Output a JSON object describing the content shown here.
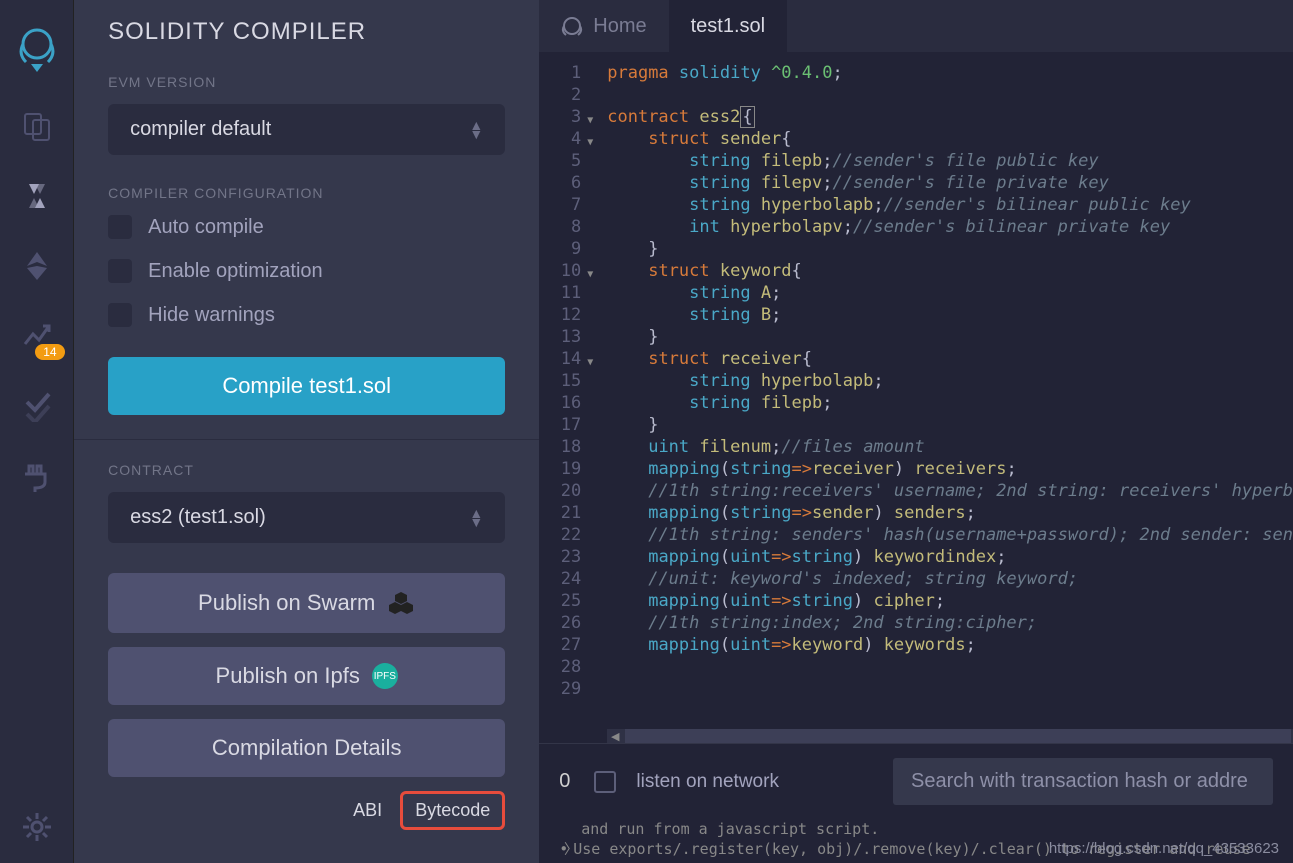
{
  "title": "SOLIDITY COMPILER",
  "evm_label": "EVM VERSION",
  "evm_value": "compiler default",
  "config_label": "COMPILER CONFIGURATION",
  "checks": {
    "auto": "Auto compile",
    "opt": "Enable optimization",
    "hide": "Hide warnings"
  },
  "compile_btn": "Compile test1.sol",
  "contract_label": "CONTRACT",
  "contract_value": "ess2 (test1.sol)",
  "swarm_btn": "Publish on Swarm",
  "ipfs_btn": "Publish on Ipfs",
  "details_btn": "Compilation Details",
  "abi_link": "ABI",
  "bytecode_link": "Bytecode",
  "badge": "14",
  "tabs": {
    "home": "Home",
    "file": "test1.sol"
  },
  "lines": [
    {
      "n": "1",
      "t": [
        {
          "c": "kw",
          "s": "pragma"
        },
        {
          "c": "pn",
          "s": " "
        },
        {
          "c": "tv",
          "s": "solidity"
        },
        {
          "c": "pn",
          "s": " "
        },
        {
          "c": "str",
          "s": "^0.4.0"
        },
        {
          "c": "pn",
          "s": ";"
        }
      ]
    },
    {
      "n": "2",
      "t": []
    },
    {
      "n": "3",
      "fold": true,
      "t": [
        {
          "c": "kw",
          "s": "contract"
        },
        {
          "c": "pn",
          "s": " "
        },
        {
          "c": "id",
          "s": "ess2"
        },
        {
          "c": "pn cursor-bracket",
          "s": "{"
        }
      ]
    },
    {
      "n": "4",
      "fold": true,
      "indent": 1,
      "t": [
        {
          "c": "kw",
          "s": "struct"
        },
        {
          "c": "pn",
          "s": " "
        },
        {
          "c": "id",
          "s": "sender"
        },
        {
          "c": "pn",
          "s": "{"
        }
      ]
    },
    {
      "n": "5",
      "indent": 2,
      "t": [
        {
          "c": "tv",
          "s": "string"
        },
        {
          "c": "pn",
          "s": " "
        },
        {
          "c": "id",
          "s": "filepb"
        },
        {
          "c": "pn",
          "s": ";"
        },
        {
          "c": "cm",
          "s": "//sender's file public key"
        }
      ]
    },
    {
      "n": "6",
      "indent": 2,
      "t": [
        {
          "c": "tv",
          "s": "string"
        },
        {
          "c": "pn",
          "s": " "
        },
        {
          "c": "id",
          "s": "filepv"
        },
        {
          "c": "pn",
          "s": ";"
        },
        {
          "c": "cm",
          "s": "//sender's file private key"
        }
      ]
    },
    {
      "n": "7",
      "indent": 2,
      "t": [
        {
          "c": "tv",
          "s": "string"
        },
        {
          "c": "pn",
          "s": " "
        },
        {
          "c": "id",
          "s": "hyperbolapb"
        },
        {
          "c": "pn",
          "s": ";"
        },
        {
          "c": "cm",
          "s": "//sender's bilinear public key"
        }
      ]
    },
    {
      "n": "8",
      "indent": 2,
      "t": [
        {
          "c": "tv",
          "s": "int"
        },
        {
          "c": "pn",
          "s": " "
        },
        {
          "c": "id",
          "s": "hyperbolapv"
        },
        {
          "c": "pn",
          "s": ";"
        },
        {
          "c": "cm",
          "s": "//sender's bilinear private key"
        }
      ]
    },
    {
      "n": "9",
      "indent": 1,
      "t": [
        {
          "c": "pn",
          "s": "}"
        }
      ]
    },
    {
      "n": "10",
      "fold": true,
      "indent": 1,
      "t": [
        {
          "c": "kw",
          "s": "struct"
        },
        {
          "c": "pn",
          "s": " "
        },
        {
          "c": "id",
          "s": "keyword"
        },
        {
          "c": "pn",
          "s": "{"
        }
      ]
    },
    {
      "n": "11",
      "indent": 2,
      "t": [
        {
          "c": "tv",
          "s": "string"
        },
        {
          "c": "pn",
          "s": " "
        },
        {
          "c": "id",
          "s": "A"
        },
        {
          "c": "pn",
          "s": ";"
        }
      ]
    },
    {
      "n": "12",
      "indent": 2,
      "t": [
        {
          "c": "tv",
          "s": "string"
        },
        {
          "c": "pn",
          "s": " "
        },
        {
          "c": "id",
          "s": "B"
        },
        {
          "c": "pn",
          "s": ";"
        }
      ]
    },
    {
      "n": "13",
      "indent": 1,
      "t": [
        {
          "c": "pn",
          "s": "}"
        }
      ]
    },
    {
      "n": "14",
      "fold": true,
      "indent": 1,
      "t": [
        {
          "c": "kw",
          "s": "struct"
        },
        {
          "c": "pn",
          "s": " "
        },
        {
          "c": "id",
          "s": "receiver"
        },
        {
          "c": "pn",
          "s": "{"
        }
      ]
    },
    {
      "n": "15",
      "indent": 2,
      "t": [
        {
          "c": "tv",
          "s": "string"
        },
        {
          "c": "pn",
          "s": " "
        },
        {
          "c": "id",
          "s": "hyperbolapb"
        },
        {
          "c": "pn",
          "s": ";"
        }
      ]
    },
    {
      "n": "16",
      "indent": 2,
      "t": [
        {
          "c": "tv",
          "s": "string"
        },
        {
          "c": "pn",
          "s": " "
        },
        {
          "c": "id",
          "s": "filepb"
        },
        {
          "c": "pn",
          "s": ";"
        }
      ]
    },
    {
      "n": "17",
      "indent": 1,
      "t": [
        {
          "c": "pn",
          "s": "}"
        }
      ]
    },
    {
      "n": "18",
      "indent": 1,
      "t": [
        {
          "c": "tv",
          "s": "uint"
        },
        {
          "c": "pn",
          "s": " "
        },
        {
          "c": "id",
          "s": "filenum"
        },
        {
          "c": "pn",
          "s": ";"
        },
        {
          "c": "cm",
          "s": "//files amount"
        }
      ]
    },
    {
      "n": "19",
      "indent": 1,
      "t": [
        {
          "c": "tv",
          "s": "mapping"
        },
        {
          "c": "pn",
          "s": "("
        },
        {
          "c": "tv",
          "s": "string"
        },
        {
          "c": "op",
          "s": "=>"
        },
        {
          "c": "id",
          "s": "receiver"
        },
        {
          "c": "pn",
          "s": ") "
        },
        {
          "c": "id",
          "s": "receivers"
        },
        {
          "c": "pn",
          "s": ";"
        }
      ]
    },
    {
      "n": "20",
      "indent": 1,
      "t": [
        {
          "c": "cm",
          "s": "//1th string:receivers' username; 2nd string: receivers' hyperb"
        }
      ]
    },
    {
      "n": "21",
      "indent": 1,
      "t": [
        {
          "c": "tv",
          "s": "mapping"
        },
        {
          "c": "pn",
          "s": "("
        },
        {
          "c": "tv",
          "s": "string"
        },
        {
          "c": "op",
          "s": "=>"
        },
        {
          "c": "id",
          "s": "sender"
        },
        {
          "c": "pn",
          "s": ") "
        },
        {
          "c": "id",
          "s": "senders"
        },
        {
          "c": "pn",
          "s": ";"
        }
      ]
    },
    {
      "n": "22",
      "indent": 1,
      "t": [
        {
          "c": "cm",
          "s": "//1th string: senders' hash(username+password); 2nd sender: sen"
        }
      ]
    },
    {
      "n": "23",
      "indent": 1,
      "t": [
        {
          "c": "tv",
          "s": "mapping"
        },
        {
          "c": "pn",
          "s": "("
        },
        {
          "c": "tv",
          "s": "uint"
        },
        {
          "c": "op",
          "s": "=>"
        },
        {
          "c": "tv",
          "s": "string"
        },
        {
          "c": "pn",
          "s": ") "
        },
        {
          "c": "id",
          "s": "keywordindex"
        },
        {
          "c": "pn",
          "s": ";"
        }
      ]
    },
    {
      "n": "24",
      "indent": 1,
      "t": [
        {
          "c": "cm",
          "s": "//unit: keyword's indexed; string keyword;"
        }
      ]
    },
    {
      "n": "25",
      "indent": 1,
      "t": [
        {
          "c": "tv",
          "s": "mapping"
        },
        {
          "c": "pn",
          "s": "("
        },
        {
          "c": "tv",
          "s": "uint"
        },
        {
          "c": "op",
          "s": "=>"
        },
        {
          "c": "tv",
          "s": "string"
        },
        {
          "c": "pn",
          "s": ") "
        },
        {
          "c": "id",
          "s": "cipher"
        },
        {
          "c": "pn",
          "s": ";"
        }
      ]
    },
    {
      "n": "26",
      "indent": 1,
      "t": [
        {
          "c": "cm",
          "s": "//1th string:index; 2nd string:cipher;"
        }
      ]
    },
    {
      "n": "27",
      "indent": 1,
      "t": [
        {
          "c": "tv",
          "s": "mapping"
        },
        {
          "c": "pn",
          "s": "("
        },
        {
          "c": "tv",
          "s": "uint"
        },
        {
          "c": "op",
          "s": "=>"
        },
        {
          "c": "id",
          "s": "keyword"
        },
        {
          "c": "pn",
          "s": ") "
        },
        {
          "c": "id",
          "s": "keywords"
        },
        {
          "c": "pn",
          "s": ";"
        }
      ]
    },
    {
      "n": "28",
      "t": []
    },
    {
      "n": "29",
      "t": []
    }
  ],
  "console": {
    "zero": "0",
    "listen": "listen on network",
    "search": "Search with transaction hash or addre",
    "l1": "and run from a javascript script.",
    "l2": "Use exports/.register(key, obj)/.remove(key)/.clear() to register and reuse"
  },
  "watermark": "https://blog.csdn.net/qq_43533623"
}
